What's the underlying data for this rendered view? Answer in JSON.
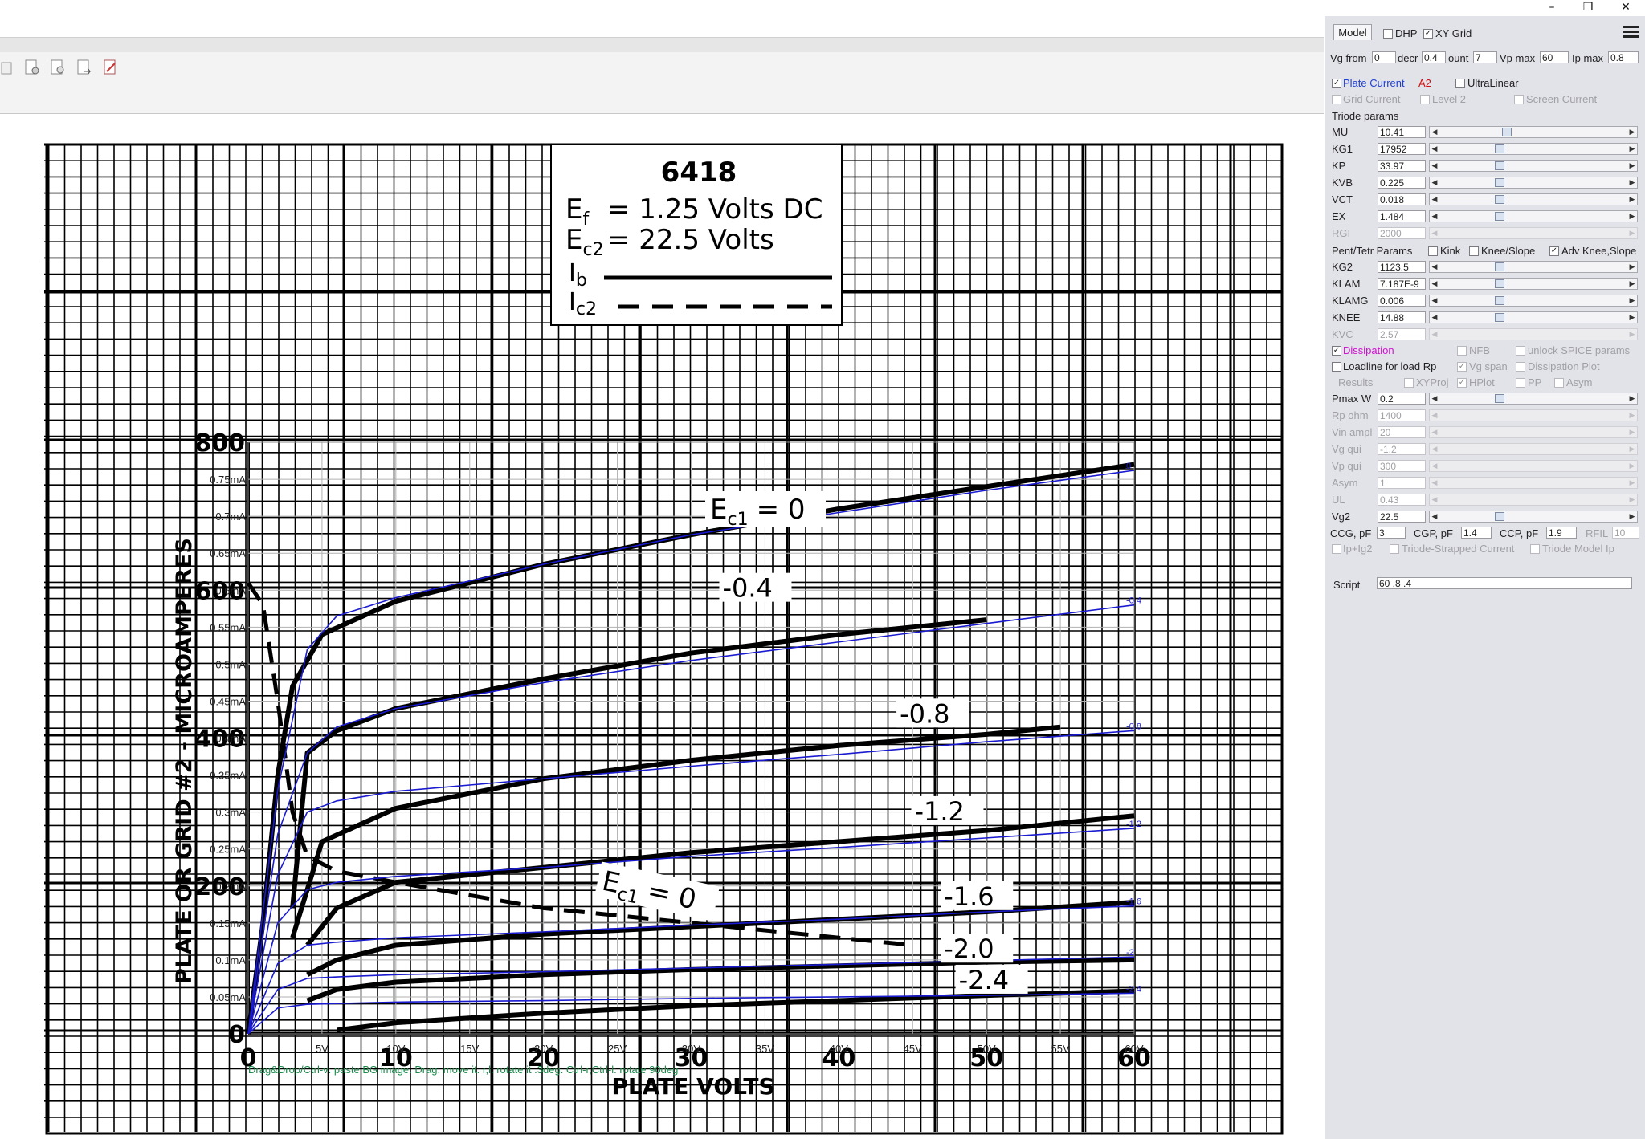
{
  "window": {
    "min_glyph": "–",
    "restore_glyph": "❐",
    "close_glyph": "✕"
  },
  "panel": {
    "tab_model": "Model",
    "dhp_label": "DHP",
    "dhp_checked": false,
    "xygrid_label": "XY Grid",
    "xygrid_checked": true,
    "vg_from_label": "Vg from",
    "vg_from": "0",
    "decr_label": "decr",
    "decr": "0.4",
    "count_label": "ount",
    "count": "7",
    "vpmax_label": "Vp max",
    "vpmax": "60",
    "ipmax_label": "Ip max",
    "ipmax": "0.8",
    "plate_current_label": "Plate Current",
    "plate_current_checked": true,
    "a2_label": "A2",
    "ultralinear_label": "UltraLinear",
    "ultralinear_checked": false,
    "grid_current_label": "Grid Current",
    "level2_label": "Level 2",
    "screen_current_label": "Screen Current",
    "triode_params_label": "Triode params",
    "triode_params": [
      {
        "name": "MU",
        "value": "10.41",
        "pos": 0.35,
        "enabled": true
      },
      {
        "name": "KG1",
        "value": "17952",
        "pos": 0.31,
        "enabled": true
      },
      {
        "name": "KP",
        "value": "33.97",
        "pos": 0.31,
        "enabled": true
      },
      {
        "name": "KVB",
        "value": "0.225",
        "pos": 0.31,
        "enabled": true
      },
      {
        "name": "VCT",
        "value": "0.018",
        "pos": 0.31,
        "enabled": true
      },
      {
        "name": "EX",
        "value": "1.484",
        "pos": 0.31,
        "enabled": true
      },
      {
        "name": "RGI",
        "value": "2000",
        "pos": 0,
        "enabled": false
      }
    ],
    "pent_params_label": "Pent/Tetr Params",
    "kink_label": "Kink",
    "kink_checked": false,
    "knee_slope_label": "Knee/Slope",
    "knee_slope_checked": false,
    "adv_knee_label": "Adv Knee,Slope",
    "adv_knee_checked": true,
    "pent_params": [
      {
        "name": "KG2",
        "value": "1123.5",
        "pos": 0.31,
        "enabled": true
      },
      {
        "name": "KLAM",
        "value": "7.187E-9",
        "pos": 0.31,
        "enabled": true
      },
      {
        "name": "KLAMG",
        "value": "0.006",
        "pos": 0.31,
        "enabled": true
      },
      {
        "name": "KNEE",
        "value": "14.88",
        "pos": 0.31,
        "enabled": true
      },
      {
        "name": "KVC",
        "value": "2.57",
        "pos": 0,
        "enabled": false
      }
    ],
    "dissipation_label": "Dissipation",
    "dissipation_checked": true,
    "nfb_label": "NFB",
    "unlock_spice_label": "unlock SPICE params",
    "loadline_label": "Loadline for load Rp",
    "vg_span_label": "Vg span",
    "dissipation_plot_label": "Dissipation Plot",
    "results_label": "Results",
    "xyproj_label": "XYProj",
    "hplot_label": "HPlot",
    "pp_label": "PP",
    "asym_cb_label": "Asym",
    "op_params": [
      {
        "name": "Pmax W",
        "value": "0.2",
        "pos": 0.31,
        "enabled": true
      },
      {
        "name": "Rp ohm",
        "value": "1400",
        "pos": 0,
        "enabled": false
      },
      {
        "name": "Vin ampl",
        "value": "20",
        "pos": 0,
        "enabled": false
      },
      {
        "name": "Vg qui",
        "value": "-1.2",
        "pos": 0,
        "enabled": false
      },
      {
        "name": "Vp qui",
        "value": "300",
        "pos": 0,
        "enabled": false
      },
      {
        "name": "Asym",
        "value": "1",
        "pos": 0,
        "enabled": false
      },
      {
        "name": "UL",
        "value": "0.43",
        "pos": 0,
        "enabled": false
      },
      {
        "name": "Vg2",
        "value": "22.5",
        "pos": 0.31,
        "enabled": true
      }
    ],
    "ccg_label": "CCG, pF",
    "ccg": "3",
    "cgp_label": "CGP, pF",
    "cgp": "1.4",
    "ccp_label": "CCP, pF",
    "ccp": "1.9",
    "rfil_label": "RFIL",
    "rfil": "10",
    "ipig2_label": "Ip+Ig2",
    "triode_strapped_label": "Triode-Strapped Current",
    "triode_model_ip_label": "Triode Model Ip",
    "script_label": "Script",
    "script_value": "60 .8 .4"
  },
  "plot": {
    "hint": "Drag&Drop/Ctrl-v: paste BG image. Drag: move it. r,l: rotate it .3deg. Ctrl-r,Ctrl-l: rotate 90deg",
    "datasheet": {
      "tube": "6418",
      "ef_line": "= 1.25 Volts DC",
      "ec2_line": "= 22.5 Volts",
      "ylabel": "PLATE OR GRID #2 - MICROAMPERES",
      "xlabel": "PLATE VOLTS",
      "y_ticks": [
        "800",
        "600",
        "400",
        "200",
        "0"
      ],
      "x_ticks": [
        "0",
        "10",
        "20",
        "30",
        "40",
        "50",
        "60"
      ],
      "curve_labels": [
        "-0.4",
        "-0.8",
        "-1.2",
        "-1.6",
        "-2.0",
        "-2.4"
      ],
      "ec1_label": "E",
      "ec1_sub": "c1",
      "ec1_eq": "= 0"
    },
    "overlay_y_ticks": [
      "0.75mA",
      "0.7mA",
      "0.65mA",
      "0.6mA",
      "0.55mA",
      "0.5mA",
      "0.45mA",
      "0.4mA",
      "0.35mA",
      "0.3mA",
      "0.25mA",
      "0.2mA",
      "0.15mA",
      "0.1mA",
      "0.05mA"
    ],
    "overlay_x_ticks": [
      "5V",
      "10V",
      "15V",
      "20V",
      "25V",
      "30V",
      "35V",
      "40V",
      "45V",
      "50V",
      "55V",
      "60V"
    ]
  },
  "chart_data": {
    "type": "line",
    "xlabel": "PLATE VOLTS",
    "ylabel": "PLATE OR GRID #2 - MICROAMPERES",
    "xlim": [
      0,
      60
    ],
    "ylim": [
      0,
      800
    ],
    "model_series": [
      {
        "name": "0",
        "points": [
          [
            0,
            0
          ],
          [
            2,
            330
          ],
          [
            4,
            520
          ],
          [
            6,
            565
          ],
          [
            10,
            590
          ],
          [
            20,
            635
          ],
          [
            30,
            675
          ],
          [
            40,
            705
          ],
          [
            50,
            735
          ],
          [
            60,
            762
          ]
        ]
      },
      {
        "name": "-0.4",
        "points": [
          [
            0,
            0
          ],
          [
            2,
            270
          ],
          [
            4,
            380
          ],
          [
            6,
            415
          ],
          [
            10,
            440
          ],
          [
            20,
            475
          ],
          [
            30,
            505
          ],
          [
            40,
            530
          ],
          [
            50,
            555
          ],
          [
            60,
            580
          ]
        ]
      },
      {
        "name": "-0.8",
        "points": [
          [
            0,
            0
          ],
          [
            2,
            215
          ],
          [
            4,
            300
          ],
          [
            6,
            315
          ],
          [
            10,
            328
          ],
          [
            20,
            345
          ],
          [
            30,
            362
          ],
          [
            40,
            378
          ],
          [
            50,
            395
          ],
          [
            60,
            410
          ]
        ]
      },
      {
        "name": "-1.2",
        "points": [
          [
            0,
            0
          ],
          [
            2,
            150
          ],
          [
            4,
            195
          ],
          [
            6,
            205
          ],
          [
            10,
            213
          ],
          [
            20,
            225
          ],
          [
            30,
            240
          ],
          [
            40,
            252
          ],
          [
            50,
            265
          ],
          [
            60,
            278
          ]
        ]
      },
      {
        "name": "-1.6",
        "points": [
          [
            0,
            0
          ],
          [
            2,
            95
          ],
          [
            4,
            120
          ],
          [
            6,
            124
          ],
          [
            10,
            130
          ],
          [
            20,
            138
          ],
          [
            30,
            147
          ],
          [
            40,
            155
          ],
          [
            50,
            165
          ],
          [
            60,
            173
          ]
        ]
      },
      {
        "name": "-2",
        "points": [
          [
            0,
            0
          ],
          [
            2,
            60
          ],
          [
            4,
            75
          ],
          [
            6,
            77
          ],
          [
            10,
            80
          ],
          [
            20,
            84
          ],
          [
            30,
            89
          ],
          [
            40,
            94
          ],
          [
            50,
            99
          ],
          [
            60,
            104
          ]
        ]
      },
      {
        "name": "-2.4",
        "points": [
          [
            0,
            0
          ],
          [
            2,
            35
          ],
          [
            4,
            40
          ],
          [
            6,
            41
          ],
          [
            10,
            43
          ],
          [
            20,
            45
          ],
          [
            30,
            48
          ],
          [
            40,
            50
          ],
          [
            50,
            52
          ],
          [
            60,
            55
          ]
        ]
      }
    ],
    "datasheet_series": [
      {
        "name": "0",
        "points": [
          [
            0,
            0
          ],
          [
            1,
            150
          ],
          [
            2,
            350
          ],
          [
            3,
            470
          ],
          [
            5,
            540
          ],
          [
            10,
            585
          ],
          [
            20,
            635
          ],
          [
            30,
            675
          ],
          [
            40,
            710
          ],
          [
            50,
            740
          ],
          [
            60,
            770
          ]
        ]
      },
      {
        "name": "-0.4",
        "points": [
          [
            3,
            170
          ],
          [
            4,
            380
          ],
          [
            6,
            410
          ],
          [
            10,
            440
          ],
          [
            20,
            480
          ],
          [
            30,
            515
          ],
          [
            40,
            540
          ],
          [
            50,
            560
          ]
        ]
      },
      {
        "name": "-0.8",
        "points": [
          [
            3,
            130
          ],
          [
            5,
            260
          ],
          [
            10,
            305
          ],
          [
            20,
            345
          ],
          [
            30,
            370
          ],
          [
            40,
            390
          ],
          [
            50,
            405
          ],
          [
            55,
            415
          ]
        ]
      },
      {
        "name": "-1.2",
        "points": [
          [
            4,
            120
          ],
          [
            6,
            170
          ],
          [
            10,
            205
          ],
          [
            20,
            225
          ],
          [
            30,
            245
          ],
          [
            40,
            260
          ],
          [
            50,
            275
          ],
          [
            60,
            295
          ]
        ]
      },
      {
        "name": "-1.6",
        "points": [
          [
            4,
            80
          ],
          [
            6,
            100
          ],
          [
            10,
            120
          ],
          [
            20,
            135
          ],
          [
            30,
            145
          ],
          [
            40,
            155
          ],
          [
            50,
            165
          ],
          [
            60,
            178
          ]
        ]
      },
      {
        "name": "-2.0",
        "points": [
          [
            4,
            45
          ],
          [
            6,
            60
          ],
          [
            10,
            70
          ],
          [
            20,
            80
          ],
          [
            30,
            87
          ],
          [
            40,
            92
          ],
          [
            50,
            97
          ],
          [
            60,
            100
          ]
        ]
      },
      {
        "name": "-2.4",
        "points": [
          [
            6,
            5
          ],
          [
            10,
            15
          ],
          [
            20,
            28
          ],
          [
            30,
            38
          ],
          [
            40,
            45
          ],
          [
            50,
            52
          ],
          [
            60,
            58
          ]
        ]
      }
    ],
    "screen_series": {
      "name": "Ec1 = 0 (Ic2)",
      "points": [
        [
          0,
          610
        ],
        [
          1,
          580
        ],
        [
          2,
          450
        ],
        [
          3,
          300
        ],
        [
          4,
          240
        ],
        [
          6,
          220
        ],
        [
          10,
          205
        ],
        [
          20,
          170
        ],
        [
          30,
          150
        ],
        [
          40,
          130
        ],
        [
          45,
          120
        ]
      ]
    },
    "grid": true
  }
}
